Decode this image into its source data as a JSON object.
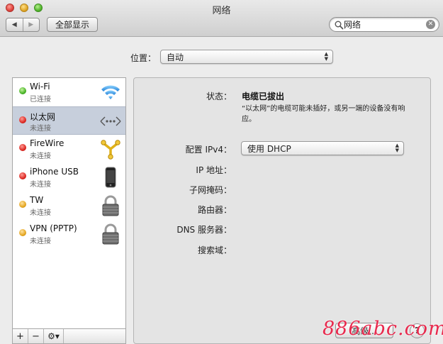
{
  "window": {
    "title": "网络"
  },
  "toolbar": {
    "back_label": "◀",
    "forward_label": "▶",
    "show_all_label": "全部显示",
    "search_value": "网络",
    "search_clear": "✕"
  },
  "location": {
    "label": "位置：",
    "value": "自动"
  },
  "services": [
    {
      "name": "Wi-Fi",
      "status": "已连接",
      "dot": "green",
      "icon": "wifi-icon"
    },
    {
      "name": "以太网",
      "status": "未连接",
      "dot": "red",
      "icon": "ethernet-icon",
      "selected": true
    },
    {
      "name": "FireWire",
      "status": "未连接",
      "dot": "red",
      "icon": "firewire-icon"
    },
    {
      "name": "iPhone USB",
      "status": "未连接",
      "dot": "red",
      "icon": "iphone-icon"
    },
    {
      "name": "TW",
      "status": "未连接",
      "dot": "yellow",
      "icon": "lock-icon"
    },
    {
      "name": "VPN (PPTP)",
      "status": "未连接",
      "dot": "yellow",
      "icon": "lock-icon"
    }
  ],
  "sidebar_buttons": {
    "add": "+",
    "remove": "−",
    "gear": "⚙▾"
  },
  "detail": {
    "status_label": "状态：",
    "status_value": "电缆已拔出",
    "status_desc": "“以太网”的电缆可能未插好，或另一端的设备没有响应。",
    "configure_label": "配置 IPv4：",
    "configure_value": "使用 DHCP",
    "ip_label": "IP 地址：",
    "subnet_label": "子网掩码：",
    "router_label": "路由器：",
    "dns_label": "DNS 服务器：",
    "search_domain_label": "搜索域：",
    "advanced_button": "高级...",
    "help_button": "?"
  },
  "watermark": "886abc.com",
  "colors": {
    "selected_row": "#c7cfdc",
    "status_green": "#3fae1f",
    "status_red": "#d9201a",
    "status_yellow": "#e2a118",
    "watermark": "#e8294d"
  }
}
